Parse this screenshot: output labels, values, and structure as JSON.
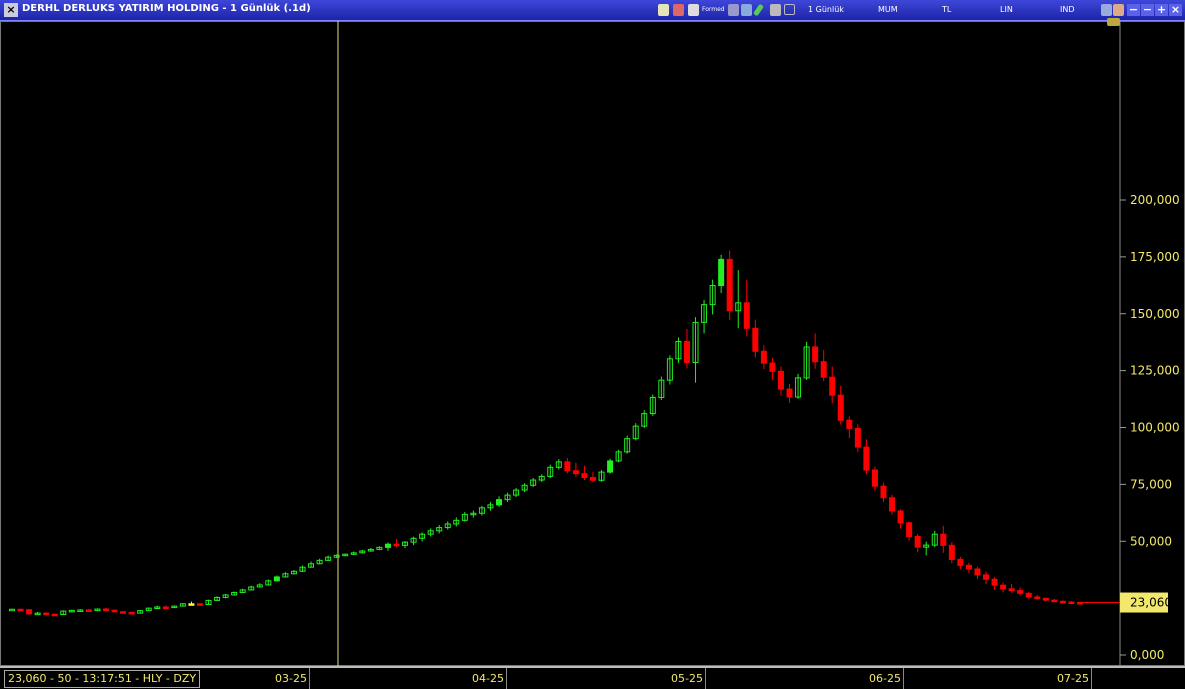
{
  "window": {
    "title": "DERHL DERLUKS YATIRIM HOLDING - 1 Günlük (.1d)",
    "close_glyph": "×",
    "toolbar": {
      "small_label": "Formed",
      "period": "1 Günlük",
      "chart_style": "MUM",
      "currency": "TL",
      "scale": "LIN",
      "mode": "IND"
    },
    "buttons": {
      "minimize": "−",
      "restore": "−",
      "add": "+",
      "close": "×"
    }
  },
  "status": "23,060 - 50 - 13:17:51 - HLY - DZY",
  "chart_data": {
    "type": "candlestick",
    "ylim": [
      0,
      210000
    ],
    "y_ticks": [
      0,
      25000,
      50000,
      75000,
      100000,
      125000,
      150000,
      175000,
      200000
    ],
    "y_tick_labels": [
      "0,000",
      "",
      "50,000",
      "75,000",
      "100,000",
      "125,000",
      "150,000",
      "175,000",
      "200,000"
    ],
    "x_labels": [
      "03-25",
      "04-25",
      "05-25",
      "06-25",
      "07-25"
    ],
    "last_price": 23060,
    "last_price_label": "23,060",
    "colors": {
      "up": "#22ee22",
      "down": "#ff0000",
      "neutral": "#ffff33",
      "axis_text": "#f2e96c",
      "cursor": "#e8e07a"
    },
    "candles": [
      [
        20000,
        20400,
        19800,
        20100
      ],
      [
        20100,
        20300,
        19700,
        19900
      ],
      [
        19900,
        20200,
        17600,
        18100
      ],
      [
        18100,
        18900,
        17800,
        18400
      ],
      [
        18400,
        18800,
        17600,
        17900
      ],
      [
        17900,
        18200,
        17400,
        17800
      ],
      [
        17800,
        19600,
        17600,
        19300
      ],
      [
        19300,
        19900,
        18900,
        19600
      ],
      [
        19600,
        20100,
        19300,
        19800
      ],
      [
        19800,
        20200,
        19500,
        19500
      ],
      [
        19500,
        20400,
        19400,
        20200
      ],
      [
        20200,
        20700,
        19300,
        19700
      ],
      [
        19700,
        19900,
        18800,
        19000
      ],
      [
        19000,
        19300,
        18500,
        18700
      ],
      [
        18700,
        19100,
        18200,
        18400
      ],
      [
        18400,
        19800,
        18200,
        19500
      ],
      [
        19500,
        20800,
        19400,
        20600
      ],
      [
        20600,
        21700,
        20300,
        21100
      ],
      [
        21100,
        21800,
        20700,
        21000
      ],
      [
        21000,
        21800,
        20800,
        21500
      ],
      [
        21500,
        22800,
        21300,
        22500
      ],
      [
        22500,
        23500,
        22300,
        22500
      ],
      [
        22500,
        22800,
        21900,
        22200
      ],
      [
        22200,
        24300,
        22100,
        24000
      ],
      [
        24000,
        25800,
        23800,
        25300
      ],
      [
        25300,
        26800,
        24900,
        26400
      ],
      [
        26400,
        27900,
        26100,
        27500
      ],
      [
        27500,
        29100,
        27300,
        28600
      ],
      [
        28600,
        30400,
        28400,
        29900
      ],
      [
        29900,
        31600,
        29700,
        30800
      ],
      [
        30800,
        33200,
        30500,
        32600
      ],
      [
        32600,
        35000,
        32300,
        34300
      ],
      [
        34300,
        36400,
        34100,
        35700
      ],
      [
        35700,
        37300,
        35400,
        36800
      ],
      [
        36800,
        39300,
        36600,
        38600
      ],
      [
        38600,
        41100,
        38400,
        40100
      ],
      [
        40100,
        42300,
        39800,
        41600
      ],
      [
        41600,
        43700,
        41300,
        43000
      ],
      [
        43000,
        44200,
        42600,
        43800
      ],
      [
        43800,
        44600,
        43400,
        44300
      ],
      [
        44300,
        45500,
        44000,
        44900
      ],
      [
        44900,
        46200,
        44600,
        45700
      ],
      [
        45700,
        47100,
        45400,
        46400
      ],
      [
        46400,
        47800,
        46100,
        47300
      ],
      [
        47300,
        49500,
        45800,
        48700
      ],
      [
        48700,
        50900,
        47200,
        48200
      ],
      [
        48200,
        50100,
        47000,
        49600
      ],
      [
        49600,
        52000,
        48300,
        51300
      ],
      [
        51300,
        53900,
        49900,
        53100
      ],
      [
        53100,
        55700,
        52100,
        54600
      ],
      [
        54600,
        57100,
        53400,
        56000
      ],
      [
        56000,
        58700,
        55100,
        57600
      ],
      [
        57600,
        60500,
        56500,
        59200
      ],
      [
        59200,
        62900,
        58600,
        61800
      ],
      [
        61800,
        63500,
        60400,
        62300
      ],
      [
        62300,
        65600,
        61300,
        64700
      ],
      [
        64700,
        67300,
        63400,
        66000
      ],
      [
        66000,
        69700,
        65100,
        68300
      ],
      [
        68300,
        71300,
        67300,
        70300
      ],
      [
        70300,
        73400,
        69400,
        72500
      ],
      [
        72500,
        75500,
        71600,
        74600
      ],
      [
        74600,
        77800,
        73800,
        76900
      ],
      [
        76900,
        79400,
        76100,
        78500
      ],
      [
        78500,
        83700,
        77800,
        82500
      ],
      [
        82500,
        86100,
        81500,
        84900
      ],
      [
        84900,
        86600,
        79900,
        81000
      ],
      [
        81000,
        84500,
        78300,
        79700
      ],
      [
        79700,
        83200,
        76900,
        78000
      ],
      [
        78000,
        80500,
        75900,
        76800
      ],
      [
        76800,
        81300,
        76200,
        80400
      ],
      [
        80400,
        86300,
        79700,
        85300
      ],
      [
        85300,
        90200,
        84700,
        89300
      ],
      [
        89300,
        96400,
        88500,
        95100
      ],
      [
        95100,
        101900,
        94300,
        100600
      ],
      [
        100600,
        107600,
        99800,
        106100
      ],
      [
        106100,
        114500,
        105100,
        113200
      ],
      [
        113200,
        122400,
        112100,
        120800
      ],
      [
        120800,
        131700,
        118900,
        130200
      ],
      [
        130200,
        139600,
        128300,
        137800
      ],
      [
        137800,
        143300,
        126000,
        128600
      ],
      [
        128600,
        148500,
        119700,
        146200
      ],
      [
        146200,
        156100,
        141300,
        154000
      ],
      [
        154000,
        165000,
        149700,
        162400
      ],
      [
        162400,
        175900,
        159100,
        173900
      ],
      [
        173900,
        177800,
        147200,
        151300
      ],
      [
        151300,
        169200,
        143600,
        154800
      ],
      [
        154800,
        164900,
        140000,
        143600
      ],
      [
        143600,
        147400,
        130800,
        133500
      ],
      [
        133500,
        136100,
        125700,
        128300
      ],
      [
        128300,
        130600,
        120800,
        124700
      ],
      [
        124700,
        126800,
        114300,
        116900
      ],
      [
        116900,
        119200,
        110800,
        113400
      ],
      [
        113400,
        123600,
        112600,
        121800
      ],
      [
        121800,
        137600,
        120900,
        135400
      ],
      [
        135400,
        141300,
        125800,
        128900
      ],
      [
        128900,
        134000,
        120400,
        122100
      ],
      [
        122100,
        126800,
        110600,
        114200
      ],
      [
        114200,
        118400,
        101300,
        103200
      ],
      [
        103200,
        104900,
        95400,
        99600
      ],
      [
        99600,
        101400,
        89200,
        91400
      ],
      [
        91400,
        94800,
        79400,
        81300
      ],
      [
        81300,
        82800,
        72100,
        74200
      ],
      [
        74200,
        75700,
        67300,
        69100
      ],
      [
        69100,
        70400,
        61700,
        63300
      ],
      [
        63300,
        64100,
        55600,
        58100
      ],
      [
        58100,
        58800,
        50300,
        52100
      ],
      [
        52100,
        53200,
        45100,
        47400
      ],
      [
        47400,
        49800,
        43800,
        48300
      ],
      [
        48300,
        54600,
        47400,
        53100
      ],
      [
        53100,
        56800,
        44900,
        48200
      ],
      [
        48200,
        49700,
        40300,
        42000
      ],
      [
        42000,
        43100,
        37800,
        39400
      ],
      [
        39400,
        40600,
        36100,
        37800
      ],
      [
        37800,
        38800,
        33400,
        35200
      ],
      [
        35200,
        36600,
        31100,
        33300
      ],
      [
        33300,
        34300,
        28600,
        30700
      ],
      [
        30700,
        31900,
        27500,
        29100
      ],
      [
        29100,
        31200,
        27200,
        28300
      ],
      [
        28300,
        29700,
        26200,
        27100
      ],
      [
        27100,
        27800,
        24800,
        25500
      ],
      [
        25500,
        26400,
        24300,
        24900
      ],
      [
        24900,
        25200,
        23400,
        24100
      ],
      [
        24100,
        24600,
        23300,
        23600
      ],
      [
        23600,
        24000,
        22800,
        23300
      ],
      [
        23300,
        23700,
        22900,
        23100
      ],
      [
        23100,
        23300,
        22900,
        23060
      ]
    ]
  }
}
